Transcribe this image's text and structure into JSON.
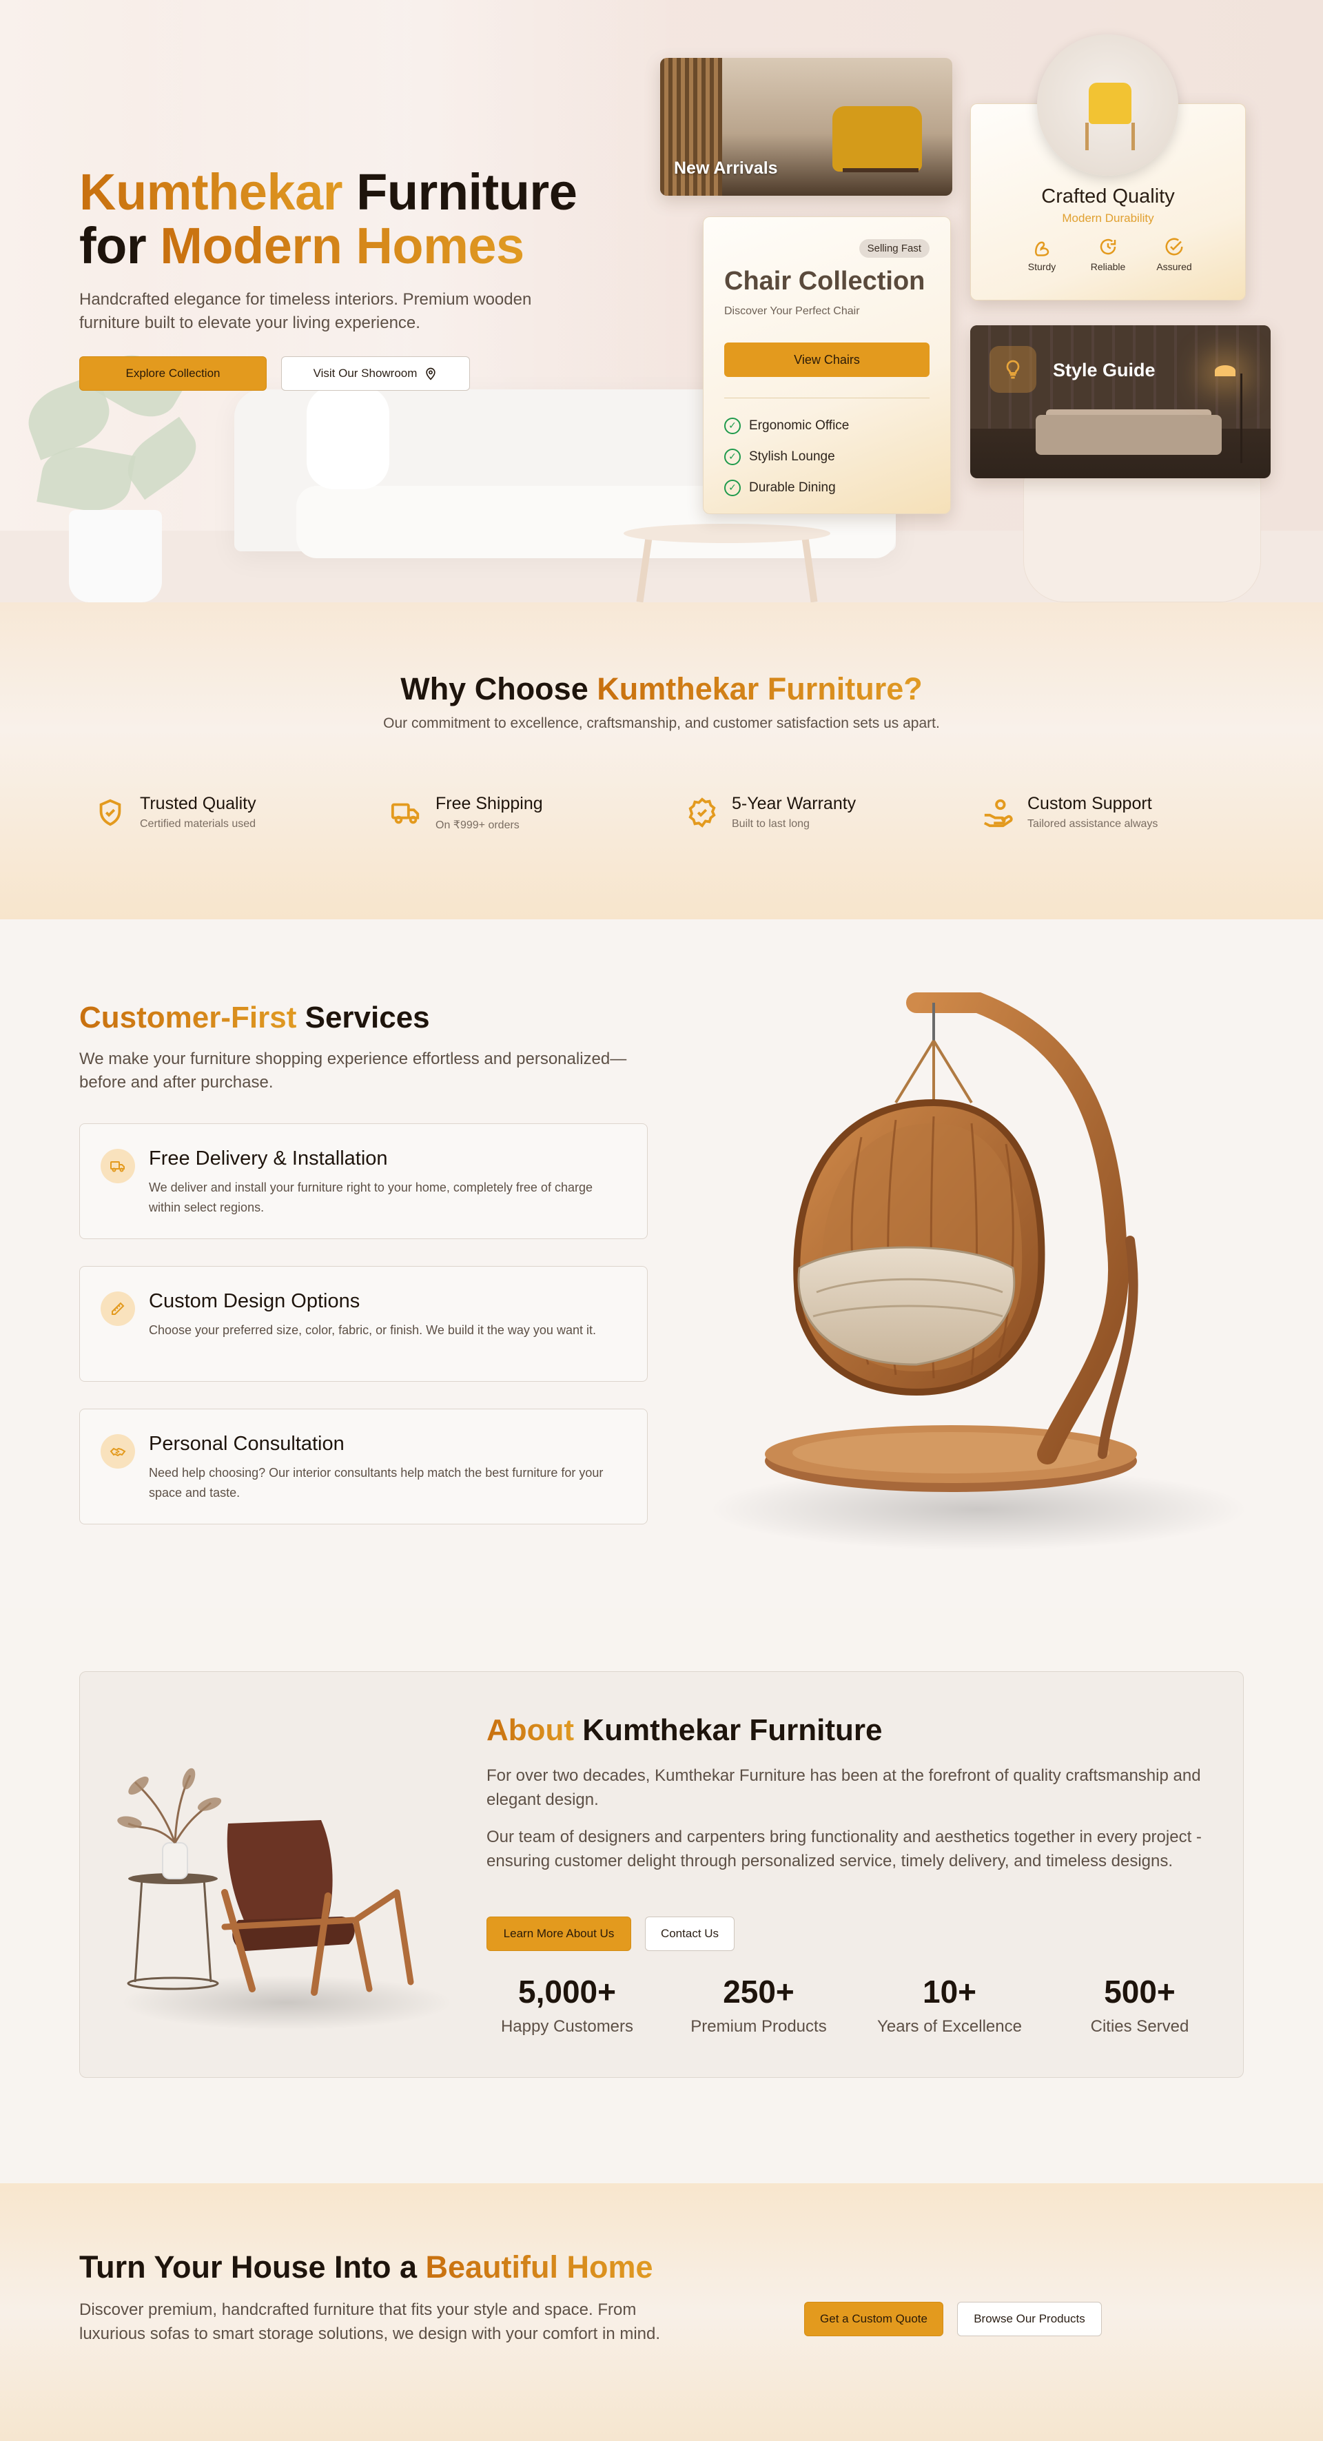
{
  "colors": {
    "accent": "#e39a1e",
    "accent_text": "#d98a1a",
    "check": "#1f9a4c",
    "background": "#f8f4f0"
  },
  "hero": {
    "title_part1": "Kumthekar",
    "title_part2": " Furniture",
    "title_part3": "for ",
    "title_part4": "Modern Homes",
    "subtitle": "Handcrafted elegance for timeless interiors. Premium wooden furniture built to elevate your living experience.",
    "explore_button": "Explore Collection",
    "showroom_button": "Visit Our Showroom",
    "showroom_icon": "map-pin-icon"
  },
  "cards": {
    "new_arrivals": {
      "label": "New Arrivals"
    },
    "chair_collection": {
      "badge": "Selling Fast",
      "title": "Chair Collection",
      "subtitle": "Discover Your Perfect Chair",
      "button": "View Chairs",
      "features": [
        "Ergonomic Office",
        "Stylish Lounge",
        "Durable Dining"
      ]
    },
    "crafted_quality": {
      "title": "Crafted Quality",
      "subtitle": "Modern Durability",
      "icons": [
        {
          "icon": "arm-icon",
          "label": "Sturdy"
        },
        {
          "icon": "refresh-icon",
          "label": "Reliable"
        },
        {
          "icon": "check-circle-icon",
          "label": "Assured"
        }
      ]
    },
    "style_guide": {
      "label": "Style Guide",
      "icon": "lightbulb-icon"
    }
  },
  "why": {
    "title_part1": "Why Choose ",
    "title_part2": "Kumthekar Furniture?",
    "subtitle": "Our commitment to excellence, craftsmanship, and customer satisfaction sets us apart.",
    "features": [
      {
        "icon": "shield-check-icon",
        "title": "Trusted Quality",
        "subtitle": "Certified materials used"
      },
      {
        "icon": "truck-icon",
        "title": "Free Shipping",
        "subtitle": "On ₹999+ orders"
      },
      {
        "icon": "badge-check-icon",
        "title": "5-Year Warranty",
        "subtitle": "Built to last long"
      },
      {
        "icon": "hand-coins-icon",
        "title": "Custom Support",
        "subtitle": "Tailored assistance always"
      }
    ]
  },
  "services": {
    "title_part1": "Customer-First",
    "title_part2": " Services",
    "subtitle": "We make your furniture shopping experience effortless and personalized—before and after purchase.",
    "items": [
      {
        "icon": "truck-icon",
        "title": "Free Delivery & Installation",
        "description": "We deliver and install your furniture right to your home, completely free of charge within select regions."
      },
      {
        "icon": "pencil-ruler-icon",
        "title": "Custom Design Options",
        "description": "Choose your preferred size, color, fabric, or finish. We build it the way you want it."
      },
      {
        "icon": "handshake-icon",
        "title": "Personal Consultation",
        "description": "Need help choosing? Our interior consultants help match the best furniture for your space and taste."
      }
    ]
  },
  "about": {
    "title_part1": "About",
    "title_part2": " Kumthekar Furniture",
    "paragraph1": "For over two decades, Kumthekar Furniture has been at the forefront of quality craftsmanship and elegant design.",
    "paragraph2": "Our team of designers and carpenters bring functionality and aesthetics together in every project - ensuring customer delight through personalized service, timely delivery, and timeless designs.",
    "learn_button": "Learn More About Us",
    "contact_button": "Contact Us",
    "stats": [
      {
        "number": "5,000+",
        "label": "Happy Customers"
      },
      {
        "number": "250+",
        "label": "Premium Products"
      },
      {
        "number": "10+",
        "label": "Years of Excellence"
      },
      {
        "number": "500+",
        "label": "Cities Served"
      }
    ]
  },
  "cta": {
    "title_part1": "Turn Your House Into a ",
    "title_part2": "Beautiful Home",
    "subtitle": "Discover premium, handcrafted furniture that fits your style and space. From luxurious sofas to smart storage solutions, we design with your comfort in mind.",
    "quote_button": "Get a Custom Quote",
    "browse_button": "Browse Our Products"
  }
}
